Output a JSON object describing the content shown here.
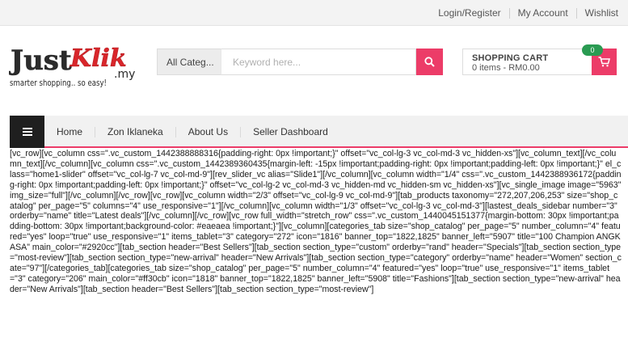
{
  "top_links": [
    "Login/Register",
    "My Account",
    "Wishlist"
  ],
  "logo": {
    "brand_left": "Just",
    "brand_right": "Klik",
    "brand_suffix": ".my",
    "tagline": "smarter shopping.. so easy!"
  },
  "search": {
    "category_label": "All Categ...",
    "placeholder": "Keyword here...",
    "icon": "search-icon"
  },
  "cart": {
    "title": "SHOPPING CART",
    "summary": "0 items - RM0.00",
    "badge_count": "0",
    "icon": "cart-icon"
  },
  "nav": {
    "menu_icon": "hamburger-icon",
    "items": [
      "Home",
      "Zon Iklaneka",
      "About Us",
      "Seller Dashboard"
    ]
  },
  "colors": {
    "accent": "#ec3c68",
    "badge": "#2a9b52",
    "logo_red": "#d9262b",
    "logo_dark": "#2b2b2b"
  },
  "body_text": "[vc_row][vc_column css=\".vc_custom_1442388888316{padding-right: 0px !important;}\" offset=\"vc_col-lg-3 vc_col-md-3 vc_hidden-xs\"][vc_column_text][/vc_column_text][/vc_column][vc_column css=\".vc_custom_1442389360435{margin-left: -15px !important;padding-right: 0px !important;padding-left: 0px !important;}\" el_class=\"home1-slider\" offset=\"vc_col-lg-7 vc_col-md-9\"][rev_slider_vc alias=\"Slide1\"][/vc_column][vc_column width=\"1/4\" css=\".vc_custom_1442388936172{padding-right: 0px !important;padding-left: 0px !important;}\" offset=\"vc_col-lg-2 vc_col-md-3 vc_hidden-md vc_hidden-sm vc_hidden-xs\"][vc_single_image image=\"5963\" img_size=\"full\"][/vc_column][/vc_row][vc_row][vc_column width=\"2/3\" offset=\"vc_col-lg-9 vc_col-md-9\"][tab_products taxonomy=\"272,207,206,253\" size=\"shop_catalog\" per_page=\"5\" columns=\"4\" use_responsive=\"1\"][/vc_column][vc_column width=\"1/3\" offset=\"vc_col-lg-3 vc_col-md-3\"][lastest_deals_sidebar number=\"3\" orderby=\"name\" title=\"Latest deals\"][/vc_column][/vc_row][vc_row full_width=\"stretch_row\" css=\".vc_custom_1440045151377{margin-bottom: 30px !important;padding-bottom: 30px !important;background-color: #eaeaea !important;}\"][vc_column][categories_tab size=\"shop_catalog\" per_page=\"5\" number_column=\"4\" featured=\"yes\" loop=\"true\" use_responsive=\"1\" items_tablet=\"3\" category=\"272\" icon=\"1816\" banner_top=\"1822,1825\" banner_left=\"5907\" title=\"100 Champion ANGKASA\" main_color=\"#2920cc\"][tab_section header=\"Best Sellers\"][tab_section section_type=\"custom\" orderby=\"rand\" header=\"Specials\"][tab_section section_type=\"most-review\"][tab_section section_type=\"new-arrival\" header=\"New Arrivals\"][tab_section section_type=\"category\" orderby=\"name\" header=\"Women\" section_cate=\"97\"][/categories_tab][categories_tab size=\"shop_catalog\" per_page=\"5\" number_column=\"4\" featured=\"yes\" loop=\"true\" use_responsive=\"1\" items_tablet=\"3\" category=\"206\" main_color=\"#ff30cb\" icon=\"1818\" banner_top=\"1822,1825\" banner_left=\"5908\" title=\"Fashions\"][tab_section section_type=\"new-arrival\" header=\"New Arrivals\"][tab_section header=\"Best Sellers\"][tab_section section_type=\"most-review\"]"
}
